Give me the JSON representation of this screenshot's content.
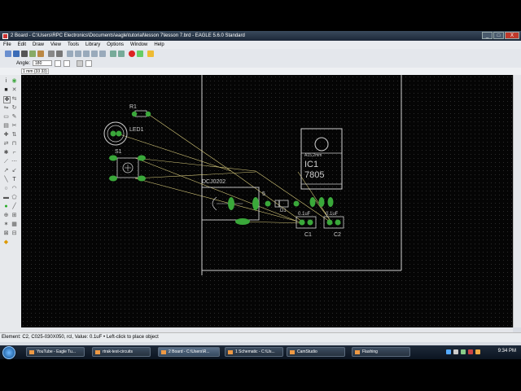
{
  "window": {
    "title": "2 Board - C:\\Users\\RPC Electronics\\Documents\\eagle\\tutorial\\lesson 7\\lesson 7.brd - EAGLE 5.6.0 Standard",
    "controls": [
      "_",
      "□",
      "X"
    ]
  },
  "menu": [
    "File",
    "Edit",
    "Draw",
    "View",
    "Tools",
    "Library",
    "Options",
    "Window",
    "Help"
  ],
  "toolbar2": {
    "angle_label": "Angle:",
    "angle_value": "180"
  },
  "coordinate_readout": "1 mm (33 33)",
  "board": {
    "labels": {
      "r1": "R1",
      "led": "LED1",
      "s1": "S1",
      "dcj": "DCJ0202",
      "d1": "D1",
      "ic_name": "IC1",
      "ic_value": "7805",
      "ic_pkg": "A15,2mm",
      "c1_label": "C1",
      "c2_label": "C2",
      "c1_value": "0.1uF",
      "c2_value": "0.1uF",
      "five": "5"
    },
    "colors": {
      "pad": "#3aa83a",
      "silk": "#cfcfcf",
      "airwire": "#d6c97a",
      "outline": "#cfcfcf"
    }
  },
  "status_bar": "Element: C2, C025-030X050, rcl, Value: 0.1uF • Left-click to place object",
  "taskbar": {
    "items": [
      {
        "label": "YouTube - Eagle Tu...",
        "active": false
      },
      {
        "label": "rtrak-test-circuits",
        "active": false
      },
      {
        "label": "2 Board - C:\\Users\\R...",
        "active": true
      },
      {
        "label": "1 Schematic - C:\\Us...",
        "active": false
      },
      {
        "label": "CamStudio",
        "active": false
      },
      {
        "label": "Flashing",
        "active": false
      }
    ],
    "clock": "9:34 PM"
  }
}
